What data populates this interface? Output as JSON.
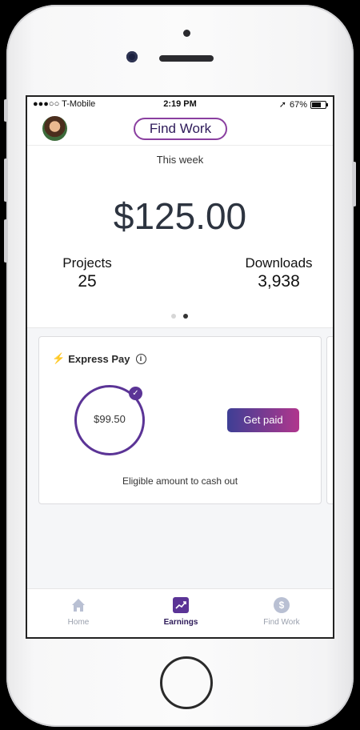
{
  "status_bar": {
    "carrier": "●●●○○ T-Mobile",
    "time": "2:19 PM",
    "battery": "67%"
  },
  "header": {
    "find_work_label": "Find Work"
  },
  "summary": {
    "period_label": "This week",
    "amount": "$125.00",
    "projects_label": "Projects",
    "projects_value": "25",
    "downloads_label": "Downloads",
    "downloads_value": "3,938",
    "page_count": 2,
    "active_page": 2
  },
  "express_pay": {
    "title": "Express Pay",
    "amount": "$99.50",
    "button_label": "Get paid",
    "caption": "Eligible amount to cash out"
  },
  "tabs": [
    {
      "label": "Home",
      "icon": "home-icon",
      "active": false
    },
    {
      "label": "Earnings",
      "icon": "trending-up-icon",
      "active": true
    },
    {
      "label": "Find Work",
      "icon": "dollar-icon",
      "active": false
    }
  ],
  "colors": {
    "accent": "#5b3496",
    "active_tab": "#2d1a59",
    "inactive_tab": "#9aa0ad",
    "button_gradient_start": "#3e3f95",
    "button_gradient_end": "#b0368d"
  }
}
